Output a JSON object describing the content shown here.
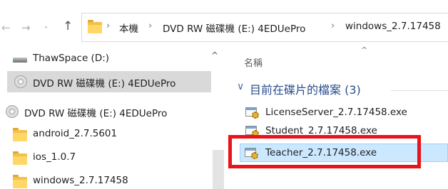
{
  "nav": {
    "back_glyph": "←",
    "forward_glyph": "→",
    "history_glyph": "˅",
    "up_glyph": "↑"
  },
  "addressbar": {
    "separator": "›",
    "crumbs": [
      "本機",
      "DVD RW 磁碟機 (E:) 4EDUePro",
      "windows_2.7.17458"
    ]
  },
  "navpane": {
    "items": [
      {
        "label": "ThawSpace (D:)",
        "icon": "hard-drive-icon"
      },
      {
        "label": "DVD RW 磁碟機 (E:) 4EDUePro",
        "icon": "dvd-drive-icon",
        "selected": true
      },
      {
        "label": "DVD RW 磁碟機 (E:) 4EDUePro",
        "icon": "dvd-drive-icon"
      },
      {
        "label": "android_2.7.5601",
        "icon": "folder-icon"
      },
      {
        "label": "ios_1.0.7",
        "icon": "folder-icon"
      },
      {
        "label": "windows_2.7.17458",
        "icon": "folder-icon"
      }
    ],
    "collapse_glyph": "^"
  },
  "content": {
    "sort_glyph": "^",
    "column_name": "名稱",
    "group": {
      "chevron": "∨",
      "label": "目前在碟片的檔案 (3)"
    },
    "files": [
      {
        "name": "LicenseServer_2.7.17458.exe",
        "icon": "setup-exe-icon"
      },
      {
        "name": "Student_2.7.17458.exe",
        "icon": "setup-exe-icon"
      },
      {
        "name": "Teacher_2.7.17458.exe",
        "icon": "setup-exe-icon",
        "selected": true
      }
    ]
  },
  "colors": {
    "selection_fill": "#cce8ff",
    "selection_border": "#99d1ff",
    "annotation_red": "#e8141b",
    "group_header": "#2b4d8c",
    "folder_yellow": "#ffd766"
  }
}
